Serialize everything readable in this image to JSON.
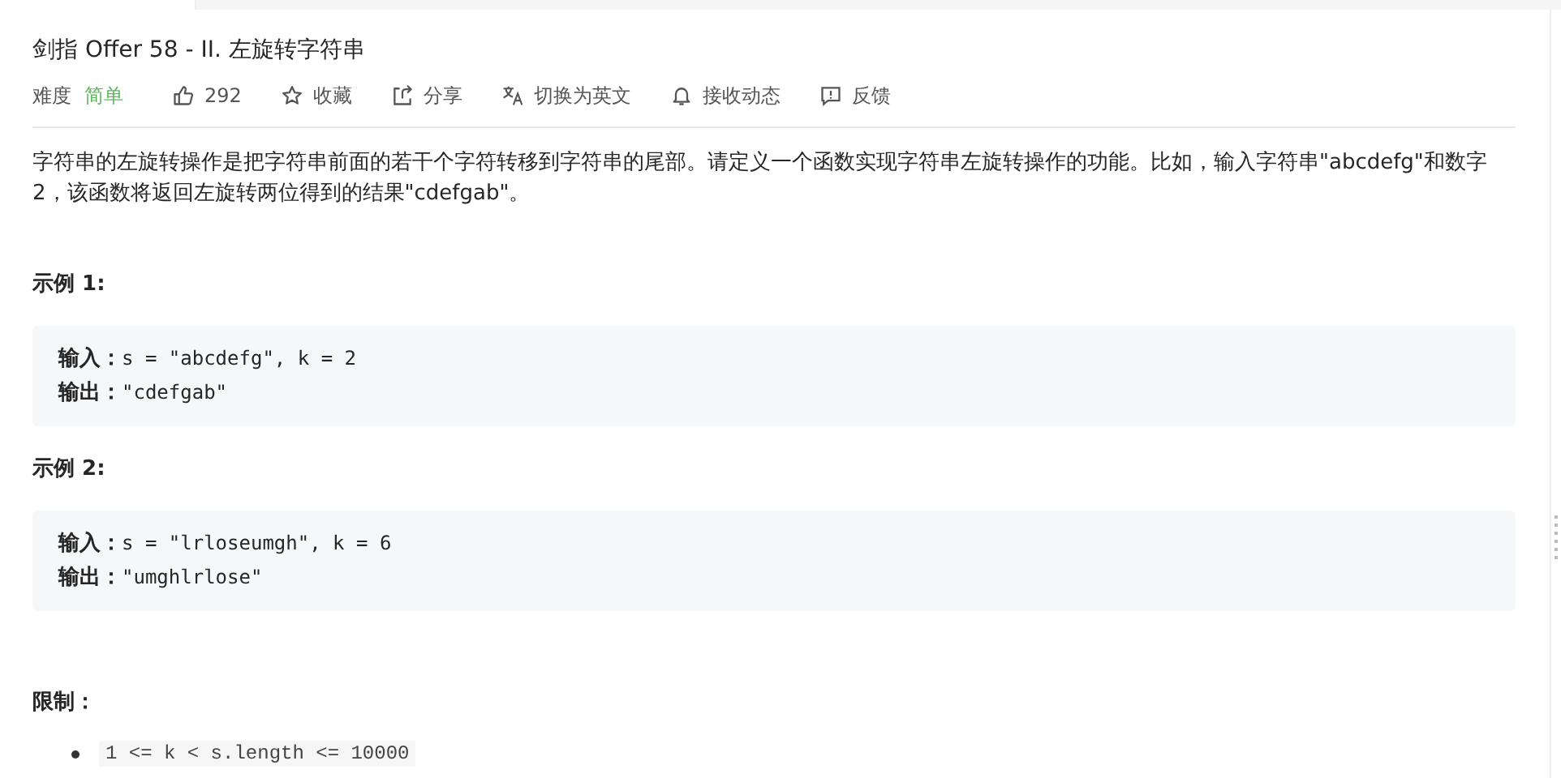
{
  "title": "剑指 Offer 58 - II. 左旋转字符串",
  "meta": {
    "difficulty_label": "难度",
    "difficulty": "简单",
    "actions": [
      {
        "kind": "like",
        "label": "292"
      },
      {
        "kind": "star",
        "label": "收藏"
      },
      {
        "kind": "share",
        "label": "分享"
      },
      {
        "kind": "translate",
        "label": "切换为英文"
      },
      {
        "kind": "bell",
        "label": "接收动态"
      },
      {
        "kind": "feedback",
        "label": "反馈"
      }
    ]
  },
  "description": "字符串的左旋转操作是把字符串前面的若干个字符转移到字符串的尾部。请定义一个函数实现字符串左旋转操作的功能。比如，输入字符串\"abcdefg\"和数字2，该函数将返回左旋转两位得到的结果\"cdefgab\"。",
  "examples": [
    {
      "title": "示例 1:",
      "lines": [
        {
          "label": "输入：",
          "value": "s = \"abcdefg\", k = 2"
        },
        {
          "label": "输出：",
          "value": "\"cdefgab\""
        }
      ]
    },
    {
      "title": "示例 2:",
      "lines": [
        {
          "label": "输入：",
          "value": "s = \"lrloseumgh\", k = 6"
        },
        {
          "label": "输出：",
          "value": "\"umghlrlose\""
        }
      ]
    }
  ],
  "constraints": {
    "title": "限制：",
    "items": [
      "1 <= k < s.length <= 10000"
    ]
  }
}
